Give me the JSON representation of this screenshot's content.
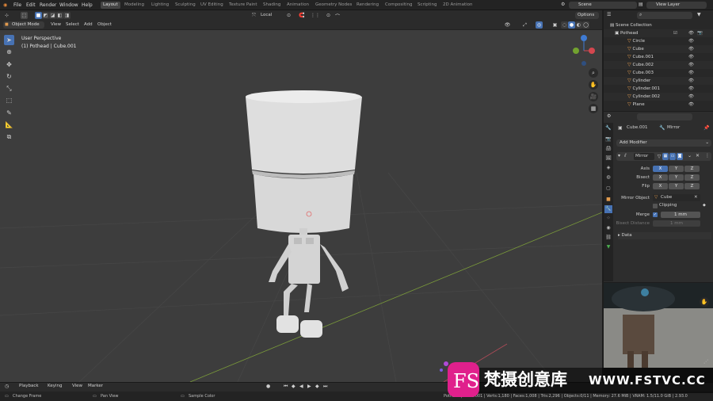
{
  "topbar": {
    "menus": [
      "File",
      "Edit",
      "Render",
      "Window",
      "Help"
    ],
    "workspaces": [
      "Layout",
      "Modeling",
      "Lighting",
      "Scripting",
      "UV Editing",
      "Texture Paint",
      "Shading",
      "Animation",
      "Geometry Nodes",
      "Rendering",
      "Compositing",
      "Scripting",
      "2D Animation"
    ],
    "active_workspace": "Layout",
    "scene": "Scene",
    "view_layer": "View Layer"
  },
  "viewport_header": {
    "transform_orientation": "Local",
    "options": "Options",
    "mode": "Object Mode",
    "menus": [
      "View",
      "Select",
      "Add",
      "Object"
    ]
  },
  "viewport": {
    "overlay_line1": "User Perspective",
    "overlay_line2": "(1) Pothead | Cube.001"
  },
  "outliner": {
    "collection": "Scene Collection",
    "items": [
      "Pothead",
      "Circle",
      "Cube",
      "Cube.001",
      "Cube.002",
      "Cube.003",
      "Cylinder",
      "Cylinder.001",
      "Cylinder.002",
      "Plane"
    ]
  },
  "properties": {
    "object_name": "Cube.001",
    "modifier_name_field": "Mirror",
    "add_modifier": "Add Modifier",
    "modifier": "Mirror",
    "rows": {
      "axis": "Axis",
      "bisect": "Bisect",
      "flip": "Flip",
      "x": "X",
      "y": "Y",
      "z": "Z"
    },
    "mirror_object_label": "Mirror Object",
    "mirror_object_value": "Cube",
    "clipping": "Clipping",
    "merge_label": "Merge",
    "merge_value": "1 mm",
    "bisect_distance_label": "Bisect Distance",
    "bisect_distance_value": "1 mm",
    "data": "Data"
  },
  "timeline": {
    "menus": [
      "Playback",
      "Keying",
      "View",
      "Marker"
    ]
  },
  "statusbar": {
    "left": "Change Frame",
    "middle": "Pan View",
    "right_action": "Sample Color",
    "stats": "Pothead | Cube.001 | Verts:1,180 | Faces:1,008 | Tris:2,296 | Objects:0/11 | Memory: 27.6 MiB | VRAM: 1.5/11.0 GiB | 2.93.0"
  },
  "watermark": {
    "logo_letters": "FS",
    "chinese": "梵摄创意库",
    "url": "WWW.FSTVC.CC"
  },
  "colors": {
    "accent_blue": "#4772b3",
    "object_orange": "#e29b4e",
    "viewport_bg": "#3d3d3d",
    "watermark_pink": "#e0208c"
  }
}
